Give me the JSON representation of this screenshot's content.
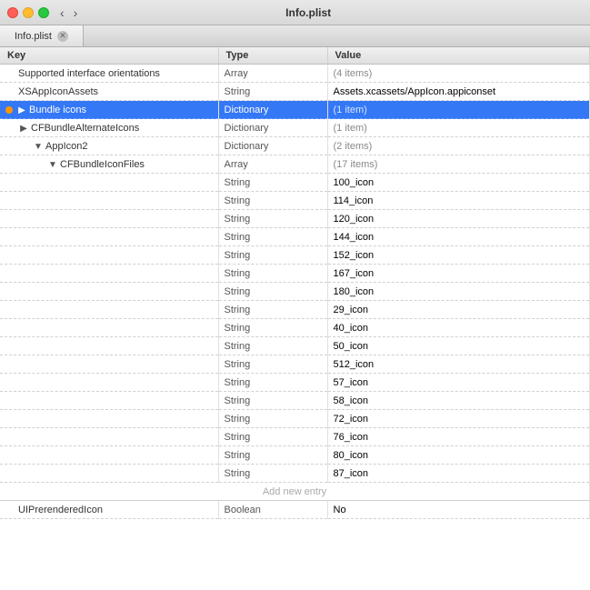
{
  "titleBar": {
    "title": "Info.plist",
    "backButton": "‹",
    "forwardButton": "›"
  },
  "table": {
    "columns": [
      "Key",
      "Type",
      "Value"
    ],
    "rows": [
      {
        "indent": 0,
        "disclosure": null,
        "key": "Supported interface orientations",
        "type": "Array",
        "value": "(4 items)",
        "valueMeta": true,
        "selected": false
      },
      {
        "indent": 0,
        "disclosure": null,
        "key": "XSAppIconAssets",
        "type": "String",
        "value": "Assets.xcassets/AppIcon.appiconset",
        "valueMeta": false,
        "selected": false
      },
      {
        "indent": 0,
        "disclosure": "▶",
        "key": "Bundle icons",
        "type": "Dictionary",
        "value": "(1 item)",
        "valueMeta": true,
        "selected": true,
        "hasWarning": true
      },
      {
        "indent": 1,
        "disclosure": "▶",
        "key": "CFBundleAlternateIcons",
        "type": "Dictionary",
        "value": "(1 item)",
        "valueMeta": true,
        "selected": false
      },
      {
        "indent": 2,
        "disclosure": "▼",
        "key": "AppIcon2",
        "type": "Dictionary",
        "value": "(2 items)",
        "valueMeta": true,
        "selected": false
      },
      {
        "indent": 3,
        "disclosure": "▼",
        "key": "CFBundleIconFiles",
        "type": "Array",
        "value": "(17 items)",
        "valueMeta": true,
        "selected": false
      },
      {
        "indent": 4,
        "disclosure": null,
        "key": "",
        "type": "String",
        "value": "100_icon",
        "valueMeta": false,
        "selected": false
      },
      {
        "indent": 4,
        "disclosure": null,
        "key": "",
        "type": "String",
        "value": "114_icon",
        "valueMeta": false,
        "selected": false
      },
      {
        "indent": 4,
        "disclosure": null,
        "key": "",
        "type": "String",
        "value": "120_icon",
        "valueMeta": false,
        "selected": false
      },
      {
        "indent": 4,
        "disclosure": null,
        "key": "",
        "type": "String",
        "value": "144_icon",
        "valueMeta": false,
        "selected": false
      },
      {
        "indent": 4,
        "disclosure": null,
        "key": "",
        "type": "String",
        "value": "152_icon",
        "valueMeta": false,
        "selected": false
      },
      {
        "indent": 4,
        "disclosure": null,
        "key": "",
        "type": "String",
        "value": "167_icon",
        "valueMeta": false,
        "selected": false
      },
      {
        "indent": 4,
        "disclosure": null,
        "key": "",
        "type": "String",
        "value": "180_icon",
        "valueMeta": false,
        "selected": false
      },
      {
        "indent": 4,
        "disclosure": null,
        "key": "",
        "type": "String",
        "value": "29_icon",
        "valueMeta": false,
        "selected": false
      },
      {
        "indent": 4,
        "disclosure": null,
        "key": "",
        "type": "String",
        "value": "40_icon",
        "valueMeta": false,
        "selected": false
      },
      {
        "indent": 4,
        "disclosure": null,
        "key": "",
        "type": "String",
        "value": "50_icon",
        "valueMeta": false,
        "selected": false
      },
      {
        "indent": 4,
        "disclosure": null,
        "key": "",
        "type": "String",
        "value": "512_icon",
        "valueMeta": false,
        "selected": false
      },
      {
        "indent": 4,
        "disclosure": null,
        "key": "",
        "type": "String",
        "value": "57_icon",
        "valueMeta": false,
        "selected": false
      },
      {
        "indent": 4,
        "disclosure": null,
        "key": "",
        "type": "String",
        "value": "58_icon",
        "valueMeta": false,
        "selected": false
      },
      {
        "indent": 4,
        "disclosure": null,
        "key": "",
        "type": "String",
        "value": "72_icon",
        "valueMeta": false,
        "selected": false
      },
      {
        "indent": 4,
        "disclosure": null,
        "key": "",
        "type": "String",
        "value": "76_icon",
        "valueMeta": false,
        "selected": false
      },
      {
        "indent": 4,
        "disclosure": null,
        "key": "",
        "type": "String",
        "value": "80_icon",
        "valueMeta": false,
        "selected": false
      },
      {
        "indent": 4,
        "disclosure": null,
        "key": "",
        "type": "String",
        "value": "87_icon",
        "valueMeta": false,
        "selected": false
      },
      {
        "indent": 0,
        "disclosure": null,
        "key": "",
        "type": "",
        "value": "Add new entry",
        "valueMeta": false,
        "selected": false,
        "isAddEntry": true
      },
      {
        "indent": 0,
        "disclosure": null,
        "key": "UIPrerenderedIcon",
        "type": "Boolean",
        "value": "No",
        "valueMeta": false,
        "selected": false
      }
    ]
  }
}
